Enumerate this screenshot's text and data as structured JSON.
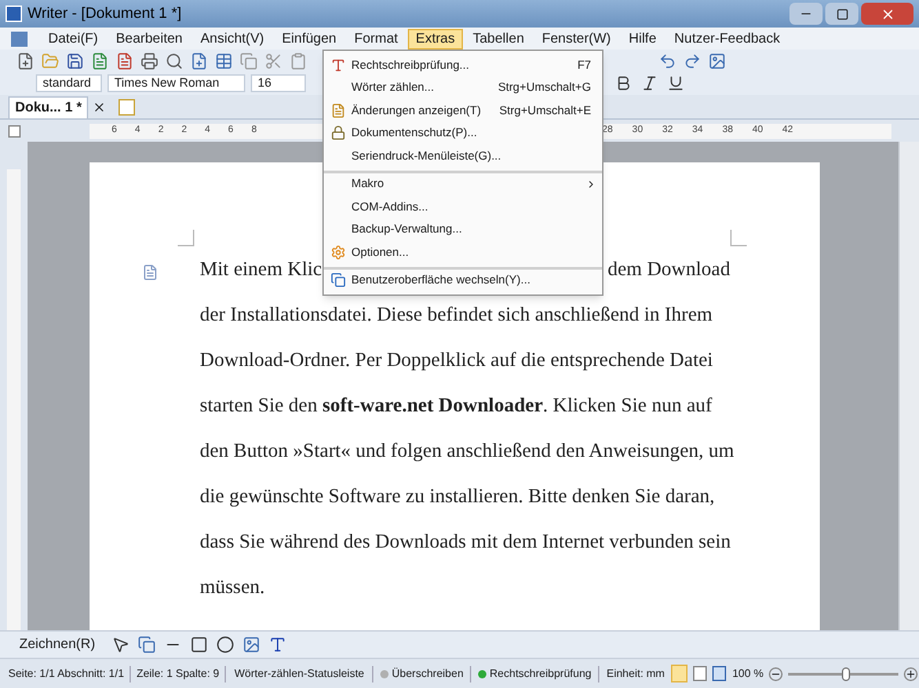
{
  "window": {
    "title": "Writer - [Dokument 1 *]"
  },
  "menu_bar": [
    {
      "label": "Datei(F)",
      "selected": false
    },
    {
      "label": "Bearbeiten",
      "selected": false
    },
    {
      "label": "Ansicht(V)",
      "selected": false
    },
    {
      "label": "Einfügen",
      "selected": false
    },
    {
      "label": "Format",
      "selected": false
    },
    {
      "label": "Extras",
      "selected": true
    },
    {
      "label": "Tabellen",
      "selected": false
    },
    {
      "label": "Fenster(W)",
      "selected": false
    },
    {
      "label": "Hilfe",
      "selected": false
    },
    {
      "label": "Nutzer-Feedback",
      "selected": false
    }
  ],
  "format_bar": {
    "style": "standard",
    "font": "Times New Roman",
    "size": "16"
  },
  "document_tabs": [
    {
      "label": "Doku... 1 *",
      "selected": true
    }
  ],
  "ruler": {
    "left_marks": [
      "6",
      "4",
      "2",
      "2",
      "4",
      "6",
      "8"
    ],
    "right_marks": [
      "28",
      "30",
      "32",
      "34",
      "38",
      "40",
      "42"
    ]
  },
  "extras_menu": [
    {
      "label": "Rechtschreibprüfung...",
      "shortcut": "F7",
      "separator_before": false,
      "submenu": false
    },
    {
      "label": "Wörter zählen...",
      "shortcut": "Strg+Umschalt+G",
      "separator_before": false,
      "submenu": false
    },
    {
      "label": "Änderungen anzeigen(T)",
      "shortcut": "Strg+Umschalt+E",
      "separator_before": false,
      "submenu": false
    },
    {
      "label": "Dokumentenschutz(P)...",
      "separator_before": false,
      "submenu": false
    },
    {
      "label": "Seriendruck-Menüleiste(G)...",
      "separator_before": false,
      "submenu": false
    },
    {
      "label": "Makro",
      "separator_before": true,
      "submenu": true
    },
    {
      "label": "COM-Addins...",
      "separator_before": false,
      "submenu": false
    },
    {
      "label": "Backup-Verwaltung...",
      "separator_before": false,
      "submenu": false
    },
    {
      "label": "Optionen...",
      "separator_before": false,
      "submenu": false
    },
    {
      "label": "Benutzeroberfläche wechseln(Y)...",
      "separator_before": true,
      "submenu": false
    }
  ],
  "document_lines": [
    {
      "left": "Mit einem Klic",
      "right": "dem Download"
    },
    {
      "left": "der Installationsdatei. Diese befindet sich anschließend in Ihrem"
    },
    {
      "left": "Download-Ordner. Per Doppelklick auf die entsprechende Datei"
    },
    {
      "left": "starten Sie den **soft-ware.net Downloader**. Klicken Sie nun auf"
    },
    {
      "left": "den Button »Start« und folgen anschließend den Anweisungen, um"
    },
    {
      "left": "die gewünschte Software zu installieren. Bitte denken Sie daran,"
    },
    {
      "left": "dass Sie während des Downloads mit dem Internet verbunden sein"
    },
    {
      "left": "müssen."
    }
  ],
  "drawing_toolbar": {
    "label": "Zeichnen(R)"
  },
  "status_bar": {
    "page": "Seite: 1/1 Abschnitt: 1/1",
    "position": "Zeile: 1 Spalte: 9",
    "word_count": "Wörter-zählen-Statusleiste",
    "indicators": [
      {
        "label": "Überschreiben",
        "on": false
      },
      {
        "label": "Rechtschreibprüfung",
        "on": true
      }
    ],
    "unit": "Einheit: mm",
    "zoom": "100 %",
    "zoom_level": {
      "level": 0.52
    }
  }
}
